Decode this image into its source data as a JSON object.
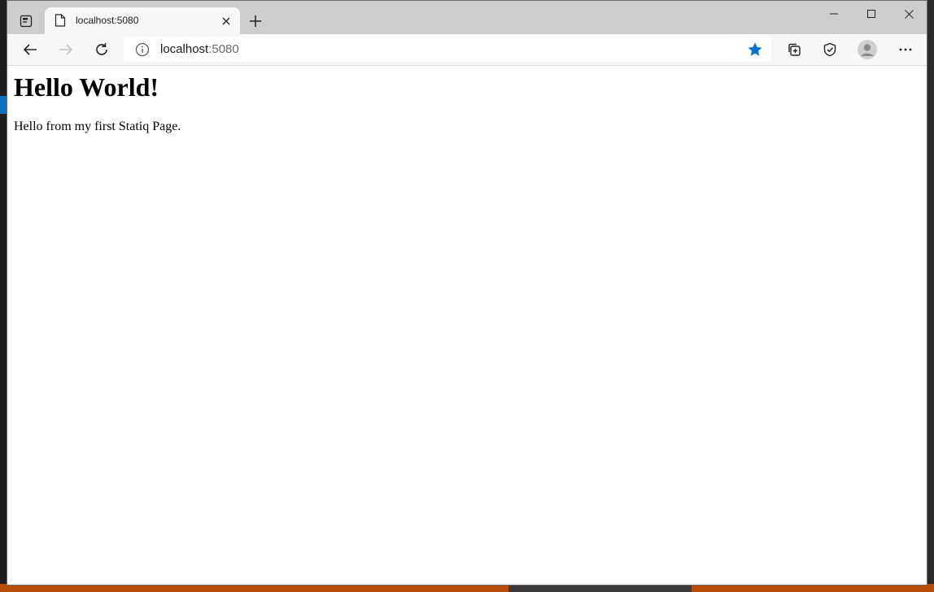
{
  "browser": {
    "tab": {
      "title": "localhost:5080"
    },
    "address": {
      "host": "localhost",
      "port": ":5080"
    },
    "accent_color": "#0a6ed1"
  },
  "page": {
    "heading": "Hello World!",
    "paragraph": "Hello from my first Statiq Page."
  }
}
